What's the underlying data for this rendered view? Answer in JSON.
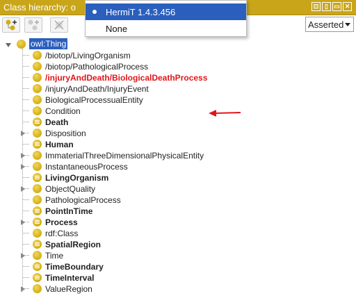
{
  "header": {
    "title": "Class hierarchy: o",
    "window_buttons": [
      "pin-icon",
      "split-icon",
      "restore-icon",
      "close-icon"
    ]
  },
  "toolbar": {
    "buttons": [
      "add-subclass-icon",
      "add-sibling-icon",
      "delete-class-icon"
    ],
    "view_mode": "Asserted"
  },
  "reasoner_menu": {
    "items": [
      {
        "label": "HermiT 1.4.3.456",
        "selected": true
      },
      {
        "label": "None",
        "selected": false
      }
    ]
  },
  "tree": {
    "root": "owl:Thing",
    "nodes": [
      {
        "label": "/biotop/LivingOrganism",
        "bold": false,
        "red": false,
        "expandable": false,
        "defined": false
      },
      {
        "label": "/biotop/PathologicalProcess",
        "bold": false,
        "red": false,
        "expandable": false,
        "defined": false
      },
      {
        "label": "/injuryAndDeath/BiologicalDeathProcess",
        "bold": true,
        "red": true,
        "expandable": false,
        "defined": false
      },
      {
        "label": "/injuryAndDeath/InjuryEvent",
        "bold": false,
        "red": false,
        "expandable": false,
        "defined": false
      },
      {
        "label": "BiologicalProcessualEntity",
        "bold": false,
        "red": false,
        "expandable": false,
        "defined": false
      },
      {
        "label": "Condition",
        "bold": false,
        "red": false,
        "expandable": false,
        "defined": false
      },
      {
        "label": "Death",
        "bold": true,
        "red": false,
        "expandable": false,
        "defined": true
      },
      {
        "label": "Disposition",
        "bold": false,
        "red": false,
        "expandable": true,
        "defined": false
      },
      {
        "label": "Human",
        "bold": true,
        "red": false,
        "expandable": false,
        "defined": true
      },
      {
        "label": "ImmaterialThreeDimensionalPhysicalEntity",
        "bold": false,
        "red": false,
        "expandable": true,
        "defined": false
      },
      {
        "label": "InstantaneousProcess",
        "bold": false,
        "red": false,
        "expandable": true,
        "defined": false
      },
      {
        "label": "LivingOrganism",
        "bold": true,
        "red": false,
        "expandable": false,
        "defined": true
      },
      {
        "label": "ObjectQuality",
        "bold": false,
        "red": false,
        "expandable": true,
        "defined": false
      },
      {
        "label": "PathologicalProcess",
        "bold": false,
        "red": false,
        "expandable": false,
        "defined": false
      },
      {
        "label": "PointInTime",
        "bold": true,
        "red": false,
        "expandable": false,
        "defined": true
      },
      {
        "label": "Process",
        "bold": true,
        "red": false,
        "expandable": true,
        "defined": true
      },
      {
        "label": "rdf:Class",
        "bold": false,
        "red": false,
        "expandable": false,
        "defined": false
      },
      {
        "label": "SpatialRegion",
        "bold": true,
        "red": false,
        "expandable": false,
        "defined": true
      },
      {
        "label": "Time",
        "bold": false,
        "red": false,
        "expandable": true,
        "defined": false
      },
      {
        "label": "TimeBoundary",
        "bold": true,
        "red": false,
        "expandable": false,
        "defined": true
      },
      {
        "label": "TimeInterval",
        "bold": true,
        "red": false,
        "expandable": false,
        "defined": true
      },
      {
        "label": "ValueRegion",
        "bold": false,
        "red": false,
        "expandable": true,
        "defined": false
      }
    ]
  },
  "annotation": {
    "arrow_color": "#e0151b"
  },
  "colors": {
    "header_bg": "#c9a51a",
    "selection": "#2b5fbe",
    "class_ball": "#d3ae14"
  }
}
